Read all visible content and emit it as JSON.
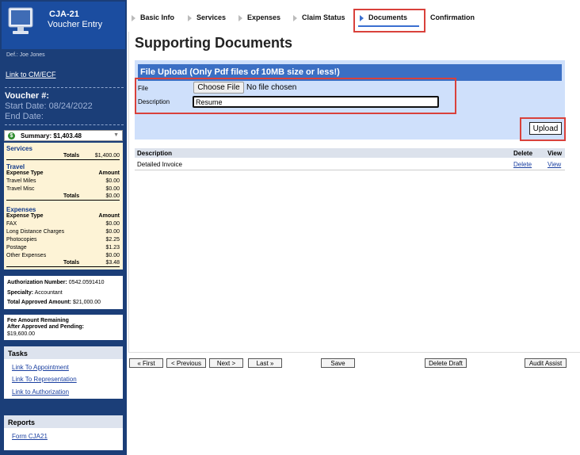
{
  "sidebar": {
    "form_title": "CJA-21",
    "form_subtitle": "Voucher Entry",
    "defendant": "Def.: Joe Jones",
    "link_cmecf": "Link to CM/ECF",
    "voucher_label": "Voucher #:",
    "start_date": "Start Date:  08/24/2022",
    "end_date": "End Date:",
    "summary": "Summary: $1,403.48",
    "services": {
      "title": "Services",
      "totals_label": "Totals",
      "totals_value": "$1,400.00"
    },
    "travel": {
      "title": "Travel",
      "col1": "Expense Type",
      "col2": "Amount",
      "rows": [
        {
          "label": "Travel Miles",
          "value": "$0.00"
        },
        {
          "label": "Travel Misc",
          "value": "$0.00"
        }
      ],
      "totals_label": "Totals",
      "totals_value": "$0.00"
    },
    "expenses": {
      "title": "Expenses",
      "col1": "Expense Type",
      "col2": "Amount",
      "rows": [
        {
          "label": "FAX",
          "value": "$0.00"
        },
        {
          "label": "Long Distance Charges",
          "value": "$0.00"
        },
        {
          "label": "Photocopies",
          "value": "$2.25"
        },
        {
          "label": "Postage",
          "value": "$1.23"
        },
        {
          "label": "Other Expenses",
          "value": "$0.00"
        }
      ],
      "totals_label": "Totals",
      "totals_value": "$3.48"
    },
    "auth": {
      "number_label": "Authorization Number:",
      "number_value": "0542.0591410",
      "specialty_label": "Specialty:",
      "specialty_value": "Accountant",
      "approved_label": "Total Approved Amount:",
      "approved_value": "$21,000.00"
    },
    "fee": {
      "line1": "Fee Amount Remaining",
      "line2": "After Approved and Pending:",
      "value": "$19,600.00"
    },
    "tasks": {
      "title": "Tasks",
      "links": [
        "Link To Appointment",
        "Link To Representation",
        "Link to Authorization"
      ]
    },
    "reports": {
      "title": "Reports",
      "links": [
        "Form CJA21"
      ]
    }
  },
  "tabs": [
    "Basic Info",
    "Services",
    "Expenses",
    "Claim Status",
    "Documents",
    "Confirmation"
  ],
  "active_tab": "Documents",
  "main": {
    "title": "Supporting Documents",
    "upload_header": "File Upload (Only Pdf files of 10MB size or less!)",
    "file_label": "File",
    "choose_button": "Choose File",
    "no_file": "No file chosen",
    "description_label": "Description",
    "description_value": "Resume",
    "upload_button": "Upload",
    "table": {
      "headers": [
        "Description",
        "Delete",
        "View"
      ],
      "rows": [
        {
          "description": "Detailed Invoice",
          "delete": "Delete",
          "view": "View"
        }
      ]
    }
  },
  "buttons": {
    "first": "« First",
    "previous": "< Previous",
    "next": "Next >",
    "last": "Last »",
    "save": "Save",
    "delete_draft": "Delete Draft",
    "audit_assist": "Audit Assist"
  },
  "colors": {
    "sidebar": "#1b3e78",
    "accent": "#3b6fc4",
    "highlight": "#d9413b",
    "summary_panel": "#fdf3d6"
  }
}
